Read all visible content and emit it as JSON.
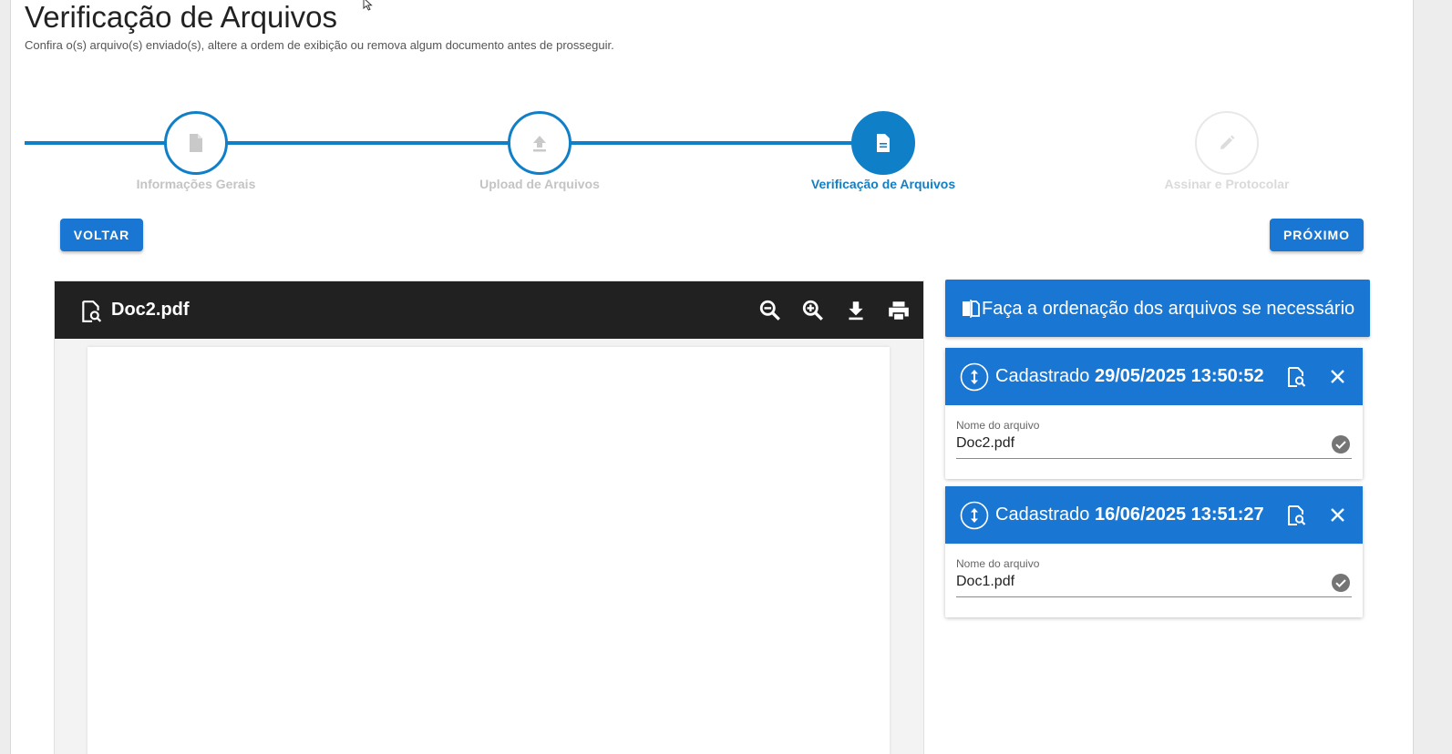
{
  "page": {
    "title": "Verificação de Arquivos",
    "subtitle": "Confira o(s) arquivo(s) enviado(s), altere a ordem de exibição ou remova algum documento antes de prosseguir."
  },
  "stepper": {
    "steps": [
      {
        "label": "Informações Gerais",
        "icon": "file-icon",
        "state": "completed"
      },
      {
        "label": "Upload de Arquivos",
        "icon": "upload-icon",
        "state": "completed"
      },
      {
        "label": "Verificação de Arquivos",
        "icon": "document-icon",
        "state": "active"
      },
      {
        "label": "Assinar e Protocolar",
        "icon": "pencil-icon",
        "state": "pending"
      }
    ]
  },
  "buttons": {
    "back": "VOLTAR",
    "next": "PRÓXIMO"
  },
  "viewer": {
    "filename": "Doc2.pdf",
    "tools": [
      "zoom-out-icon",
      "zoom-in-icon",
      "download-icon",
      "print-icon"
    ]
  },
  "ordering": {
    "header": "Faça a ordenação dos arquivos se necessário",
    "files": [
      {
        "prefix": "Cadastrado",
        "date": "29/05/2025 13:50:52",
        "field_label": "Nome do arquivo",
        "name": "Doc2.pdf"
      },
      {
        "prefix": "Cadastrado",
        "date": "16/06/2025 13:51:27",
        "field_label": "Nome do arquivo",
        "name": "Doc1.pdf"
      }
    ]
  },
  "colors": {
    "primary": "#1976d2",
    "stepper": "#0f7fc8",
    "viewer_bar": "#212121"
  }
}
